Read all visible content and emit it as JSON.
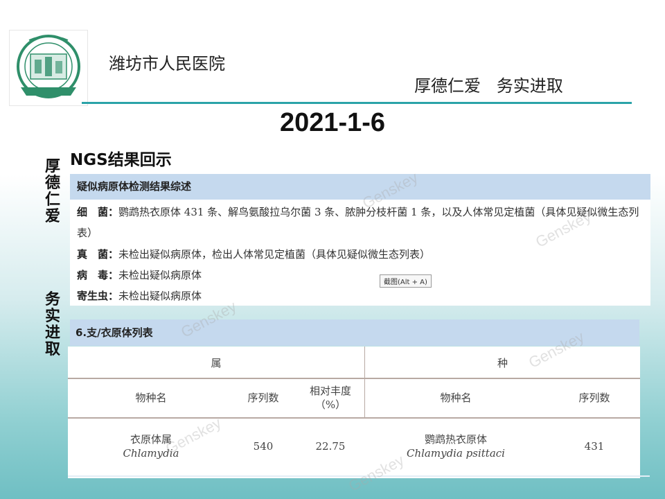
{
  "header": {
    "hospital_name": "潍坊市人民医院",
    "motto": "厚德仁爱   务实进取",
    "logo_text": "潍坊市人民医院"
  },
  "date": "2021-1-6",
  "side_motto": {
    "part1": "厚德仁爱",
    "part2": "务实进取"
  },
  "section_title": "NGS结果回示",
  "summary": {
    "title": "疑似病原体检测结果综述",
    "bacteria_label": "细　菌：",
    "bacteria_text": "鹦鹉热衣原体 431 条、解鸟氨酸拉乌尔菌 3 条、脓肿分枝杆菌 1 条，以及人体常见定植菌（具体见疑似微生态列表）",
    "fungi_label": "真　菌：",
    "fungi_text": "未检出疑似病原体，检出人体常见定植菌（具体见疑似微生态列表）",
    "virus_label": "病　毒：",
    "virus_text": "未检出疑似病原体",
    "parasite_label": "寄生虫：",
    "parasite_text": "未检出疑似病原体"
  },
  "tooltip": "截图(Alt + A)",
  "watermark": "Genskey",
  "table": {
    "title": "6.支/衣原体列表",
    "genus_header": "属",
    "species_header": "种",
    "columns": {
      "genus_name": "物种名",
      "genus_reads": "序列数",
      "abundance_line1": "相对丰度",
      "abundance_line2": "（%）",
      "species_name": "物种名",
      "species_reads": "序列数"
    },
    "rows": [
      {
        "genus_cn": "衣原体属",
        "genus_latin": "Chlamydia",
        "genus_reads": "540",
        "abundance": "22.75",
        "species_cn": "鹦鹉热衣原体",
        "species_latin": "Chlamydia psittaci",
        "species_reads": "431"
      }
    ]
  }
}
